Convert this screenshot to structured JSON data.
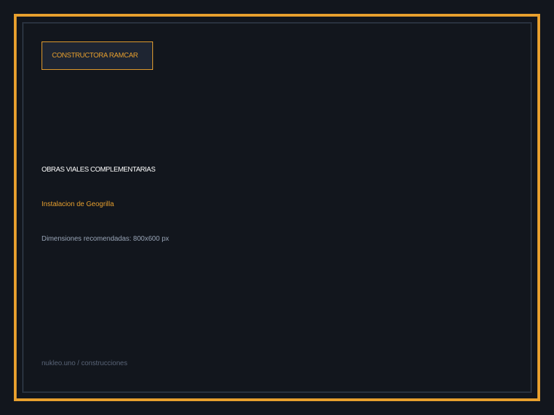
{
  "brand": {
    "label": "CONSTRUCTORA RAMCAR"
  },
  "content": {
    "category": "OBRAS VIALES COMPLEMENTARIAS",
    "service": "Instalacion de Geogrilla",
    "dimensions_note": "Dimensiones recomendadas: 800x600 px"
  },
  "footer": {
    "url": "nukleo.uno / construcciones"
  },
  "colors": {
    "background": "#12161d",
    "accent": "#e8a02e",
    "inner_border": "#2a3340",
    "brand_box_fill": "#1e2532",
    "primary_text": "#ffffff",
    "muted_text": "#9aa6b8",
    "footer_text": "#5a6578"
  }
}
